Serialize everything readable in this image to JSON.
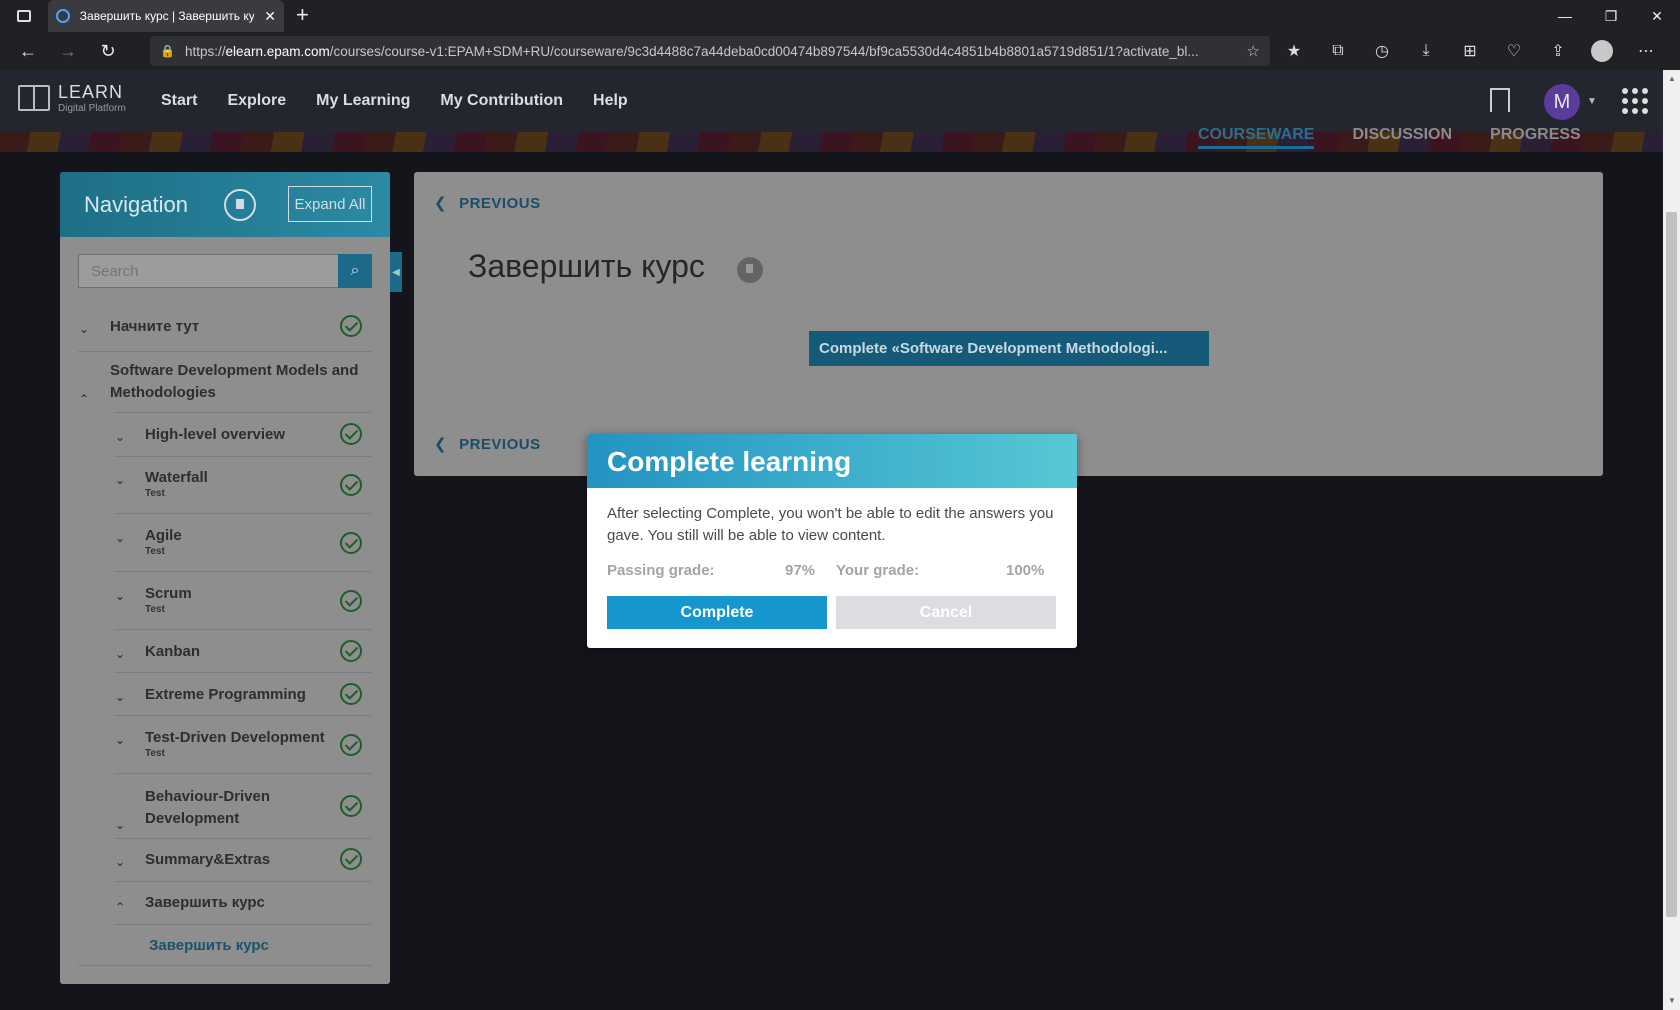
{
  "browser": {
    "tab_title": "Завершить курс | Завершить курс",
    "url_scheme": "https://",
    "url_host": "elearn.epam.com",
    "url_path": "/courses/course-v1:EPAM+SDM+RU/courseware/9c3d4488c7a44deba0cd00474b897544/bf9ca5530d4c4851b4b8801a5719d851/1?activate_bl..."
  },
  "header": {
    "logo_line1": "LEARN",
    "logo_line2": "Digital Platform",
    "nav": [
      "Start",
      "Explore",
      "My Learning",
      "My Contribution",
      "Help"
    ],
    "avatar_letter": "M"
  },
  "course_tabs": [
    "COURSEWARE",
    "DISCUSSION",
    "PROGRESS"
  ],
  "sidebar": {
    "title": "Navigation",
    "expand_all": "Expand All",
    "search_placeholder": "Search",
    "items": [
      {
        "label": "Начните тут",
        "sub": ""
      },
      {
        "label": "Software Development Models and Methodologies",
        "sub": ""
      },
      {
        "label": "High-level overview",
        "sub": ""
      },
      {
        "label": "Waterfall",
        "sub": "Test"
      },
      {
        "label": "Agile",
        "sub": "Test"
      },
      {
        "label": "Scrum",
        "sub": "Test"
      },
      {
        "label": "Kanban",
        "sub": ""
      },
      {
        "label": "Extreme Programming",
        "sub": ""
      },
      {
        "label": "Test-Driven Development",
        "sub": "Test"
      },
      {
        "label": "Behaviour-Driven Development",
        "sub": ""
      },
      {
        "label": "Summary&Extras",
        "sub": ""
      },
      {
        "label": "Завершить курс",
        "sub": ""
      }
    ],
    "current_unit": "Завершить курс"
  },
  "content": {
    "previous_label": "PREVIOUS",
    "unit_title": "Завершить курс",
    "complete_banner": "Complete  «Software Development Methodologi..."
  },
  "modal": {
    "title": "Complete learning",
    "body": "After selecting Complete, you won't be able to edit the answers you gave. You still will be able to view content.",
    "passing_label": "Passing grade:",
    "passing_value": "97%",
    "your_label": "Your grade:",
    "your_value": "100%",
    "complete_btn": "Complete",
    "cancel_btn": "Cancel"
  },
  "colors": {
    "accent": "#1596cd",
    "modal_header_start": "#2393c2",
    "modal_header_end": "#56c8d4",
    "check_green": "#1d5e2a"
  }
}
